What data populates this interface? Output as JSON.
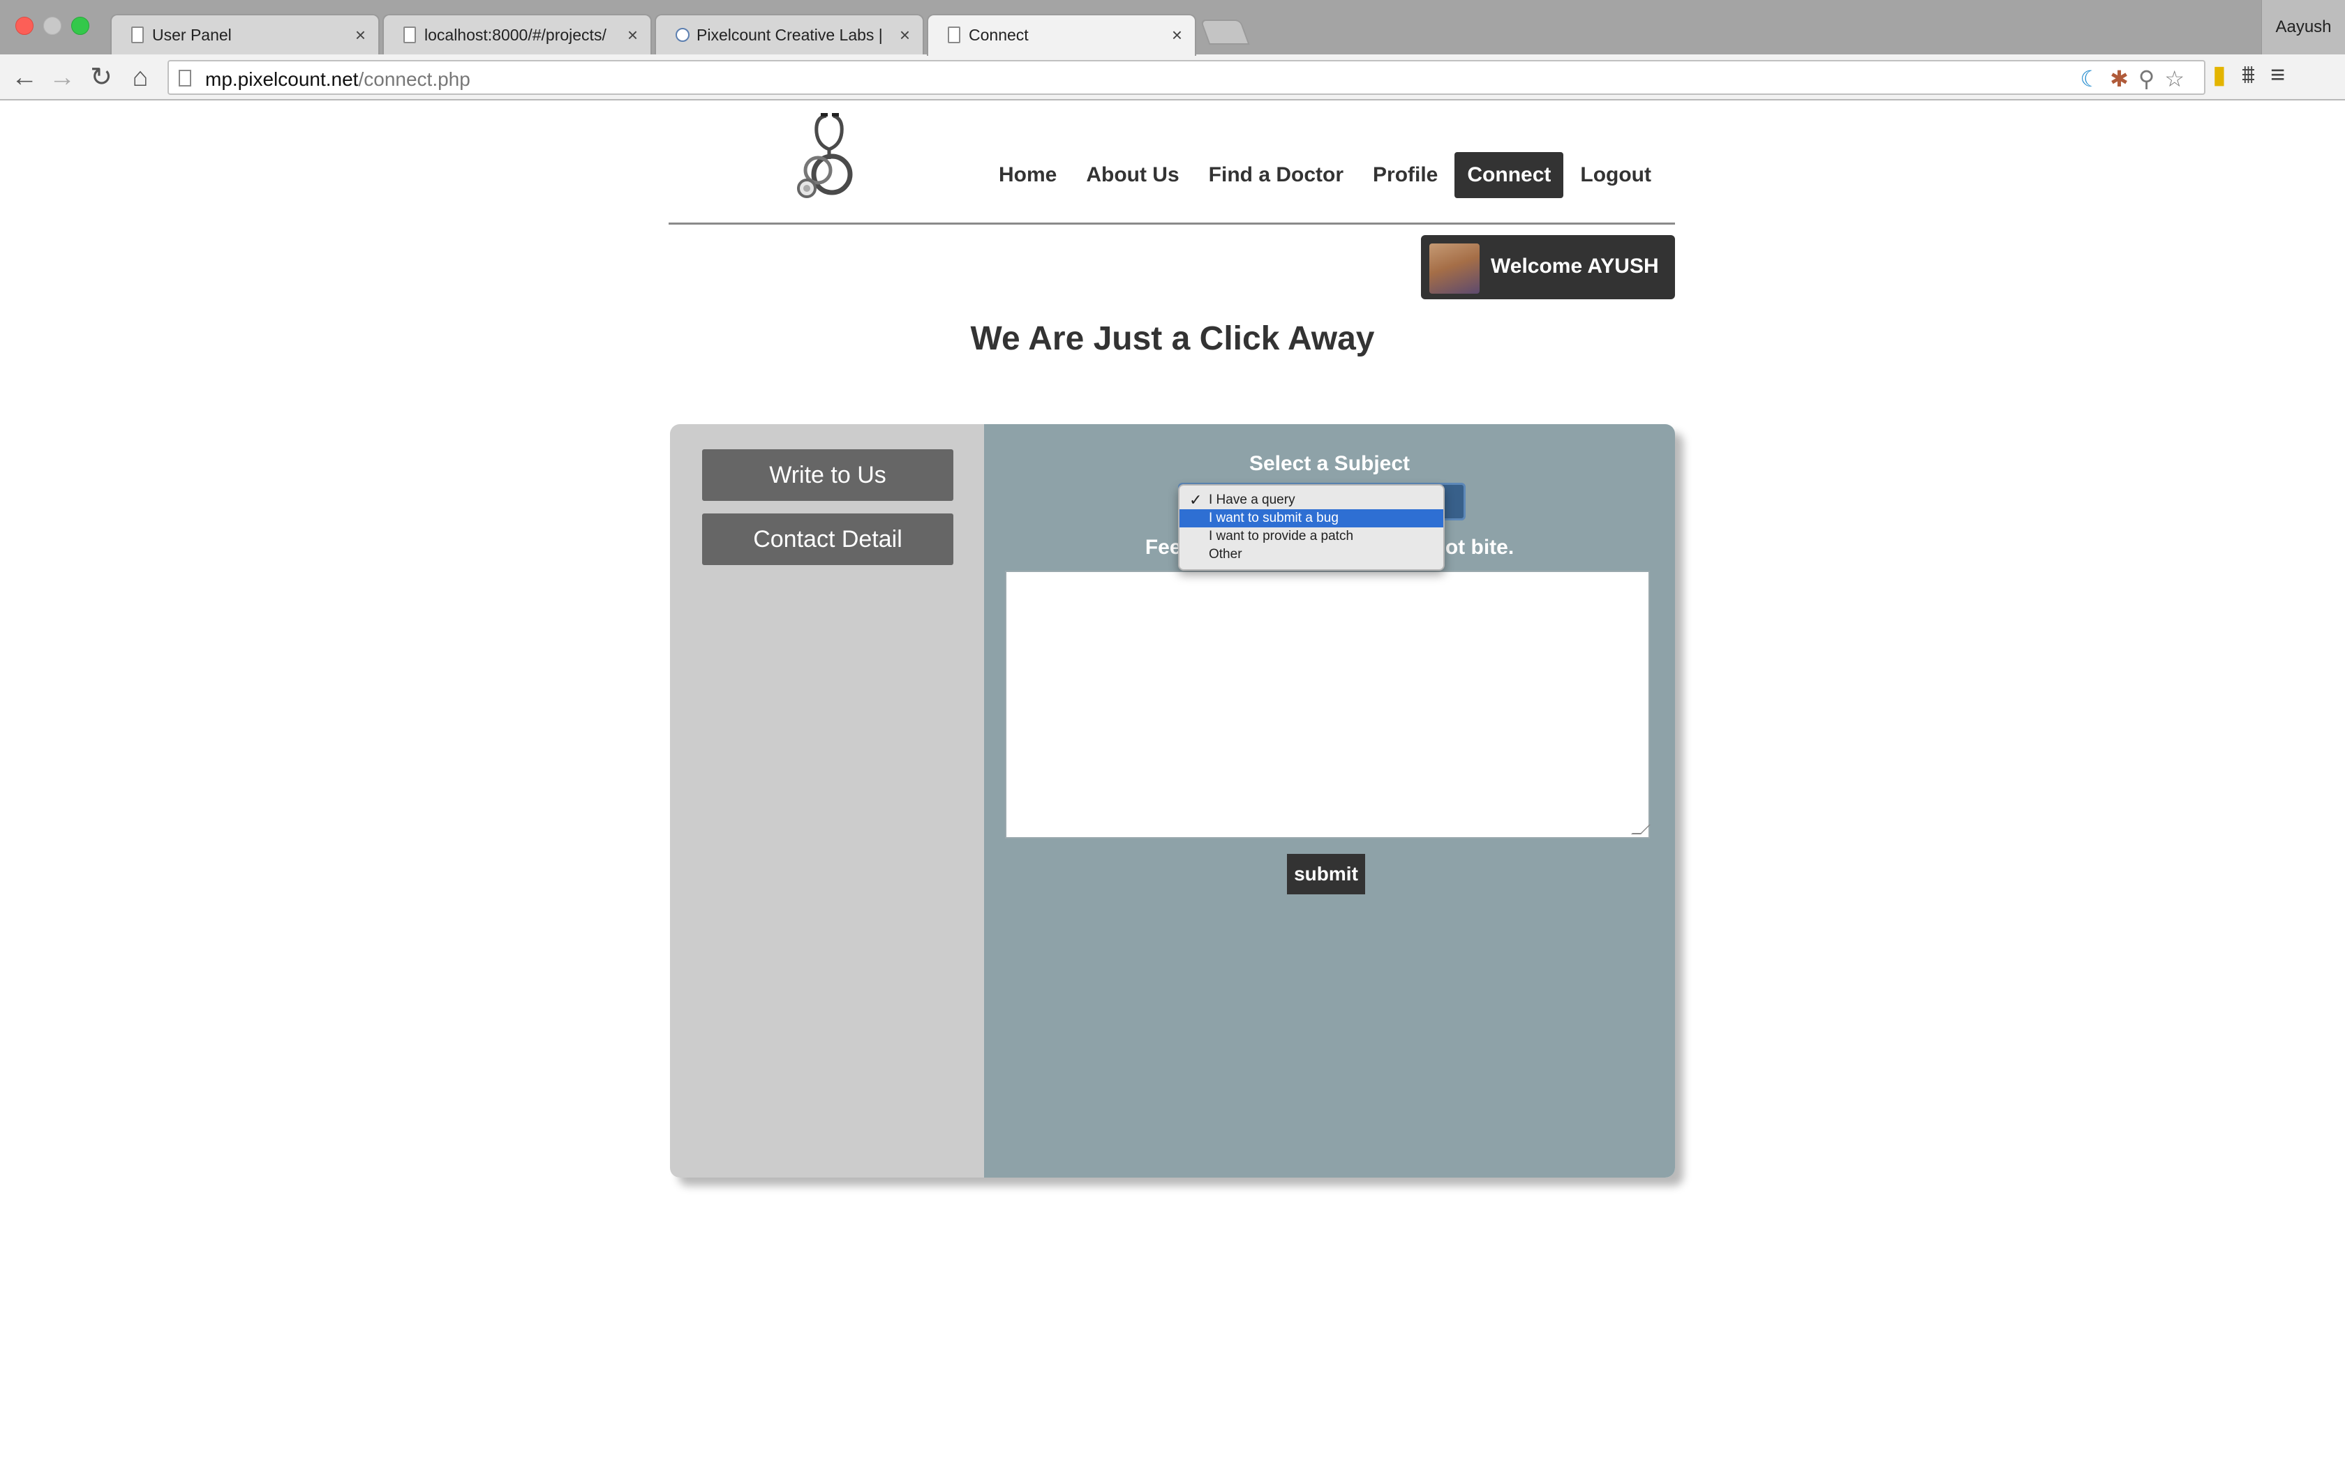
{
  "browser": {
    "tabs": [
      {
        "title": "User Panel",
        "close": "×"
      },
      {
        "title": "localhost:8000/#/projects/",
        "close": "×"
      },
      {
        "title": "Pixelcount Creative Labs |",
        "close": "×"
      },
      {
        "title": "Connect",
        "close": "×"
      }
    ],
    "profile_name": "Aayush",
    "url_host": "mp.pixelcount.net",
    "url_path": "/connect.php",
    "icons": {
      "back": "←",
      "forward": "→",
      "reload": "↻",
      "home": "⌂",
      "star": "☆",
      "menu": "≡"
    }
  },
  "nav": {
    "items": [
      "Home",
      "About Us",
      "Find a Doctor",
      "Profile",
      "Connect",
      "Logout"
    ],
    "active": "Connect"
  },
  "welcome": {
    "text": "Welcome AYUSH"
  },
  "page_title": "We Are Just a Click Away",
  "sidebar": {
    "write_label": "Write to Us",
    "contact_label": "Contact Detail"
  },
  "form": {
    "subject_label": "Select a Subject",
    "feel_left": "Feel",
    "feel_right": "ot bite.",
    "submit_label": "submit",
    "options": [
      "I Have a query",
      "I want to submit a bug",
      "I want to provide a patch",
      "Other"
    ],
    "checked_option": "I Have a query",
    "highlighted_option": "I want to submit a bug"
  },
  "colors": {
    "content_bg": "#8ea2a8",
    "sidebar_bg": "#cccccc",
    "dark": "#333333",
    "button": "#666666",
    "highlight": "#2e6fd3"
  }
}
